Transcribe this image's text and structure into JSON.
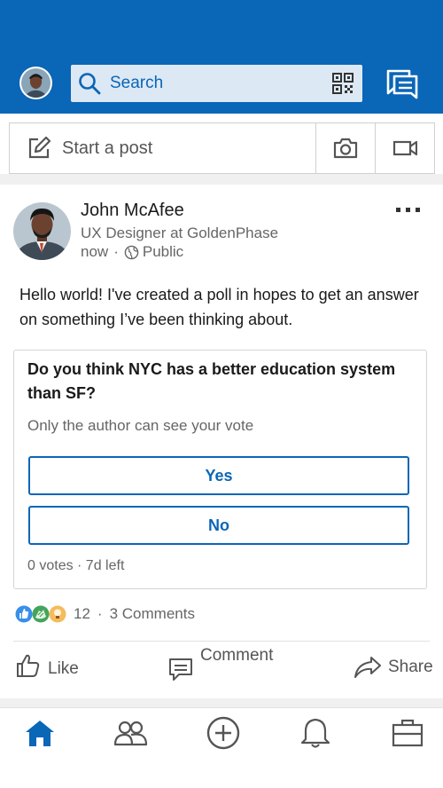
{
  "header": {
    "search_placeholder": "Search"
  },
  "composer": {
    "start_post_label": "Start a post"
  },
  "post": {
    "author_name": "John McAfee",
    "author_title": "UX Designer at GoldenPhase",
    "time": "now",
    "separator": "·",
    "visibility": "Public",
    "text": "Hello world! I've created a poll in hopes to get an answer on something I’ve been thinking about.",
    "poll": {
      "question": "Do you think NYC has a better education system than SF?",
      "note": "Only the author can see your vote",
      "options": [
        "Yes",
        "No"
      ],
      "stats": "0 votes · 7d left"
    },
    "reactions": {
      "count": "12",
      "separator": "·",
      "comments": "3 Comments"
    },
    "actions": {
      "like": "Like",
      "comment": "Comment",
      "share": "Share"
    }
  },
  "colors": {
    "brand": "#0a66b7",
    "search_bg": "#dce8f4",
    "text_secondary": "#666666"
  },
  "icons": {
    "profile": "avatar",
    "search": "search-icon",
    "qr": "qr-code-icon",
    "messaging": "messaging-icon",
    "edit": "edit-icon",
    "camera": "camera-icon",
    "video": "video-icon",
    "more": "more-icon",
    "globe": "globe-icon",
    "like": "like-icon",
    "comment": "comment-icon",
    "share": "share-icon",
    "home": "home-icon",
    "network": "network-icon",
    "post": "add-post-icon",
    "notifications": "bell-icon",
    "jobs": "briefcase-icon"
  }
}
